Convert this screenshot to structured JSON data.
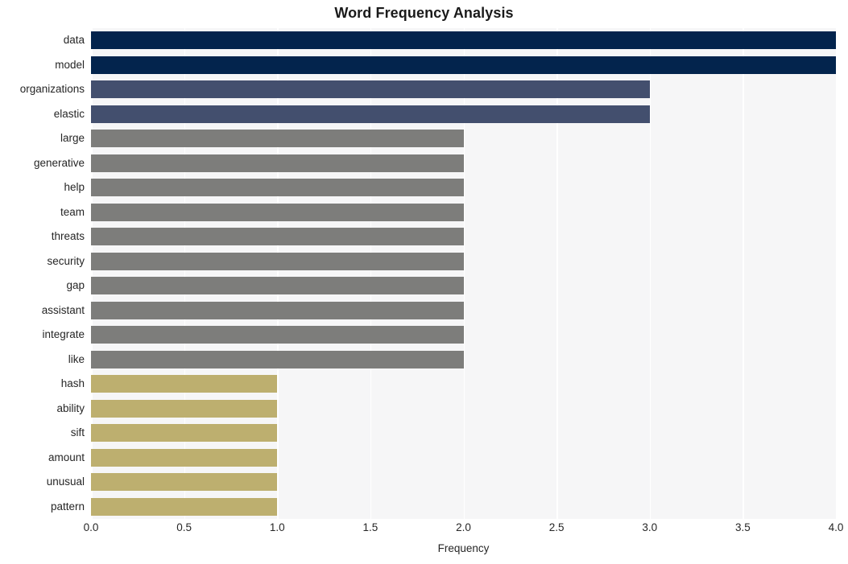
{
  "chart_data": {
    "type": "bar",
    "orientation": "horizontal",
    "title": "Word Frequency Analysis",
    "xlabel": "Frequency",
    "ylabel": "",
    "xlim": [
      0.0,
      4.0
    ],
    "xticks": [
      "0.0",
      "0.5",
      "1.0",
      "1.5",
      "2.0",
      "2.5",
      "3.0",
      "3.5",
      "4.0"
    ],
    "xtick_values": [
      0.0,
      0.5,
      1.0,
      1.5,
      2.0,
      2.5,
      3.0,
      3.5,
      4.0
    ],
    "grid": "vertical-white-on-light-gray",
    "legend": "none",
    "categories": [
      "data",
      "model",
      "organizations",
      "elastic",
      "large",
      "generative",
      "help",
      "team",
      "threats",
      "security",
      "gap",
      "assistant",
      "integrate",
      "like",
      "hash",
      "ability",
      "sift",
      "amount",
      "unusual",
      "pattern"
    ],
    "values": [
      4,
      4,
      3,
      3,
      2,
      2,
      2,
      2,
      2,
      2,
      2,
      2,
      2,
      2,
      1,
      1,
      1,
      1,
      1,
      1
    ],
    "bar_colors": [
      "#03244d",
      "#03244d",
      "#434f6e",
      "#434f6e",
      "#7d7d7b",
      "#7d7d7b",
      "#7d7d7b",
      "#7d7d7b",
      "#7d7d7b",
      "#7d7d7b",
      "#7d7d7b",
      "#7d7d7b",
      "#7d7d7b",
      "#7d7d7b",
      "#bdaf6f",
      "#bdaf6f",
      "#bdaf6f",
      "#bdaf6f",
      "#bdaf6f",
      "#bdaf6f"
    ],
    "palette": {
      "navy": "#03244d",
      "slate": "#434f6e",
      "gray": "#7d7d7b",
      "khaki": "#bdaf6f"
    },
    "plot_background": "#f6f6f7",
    "gridline_color": "#ffffff",
    "figure_background": "#ffffff"
  }
}
